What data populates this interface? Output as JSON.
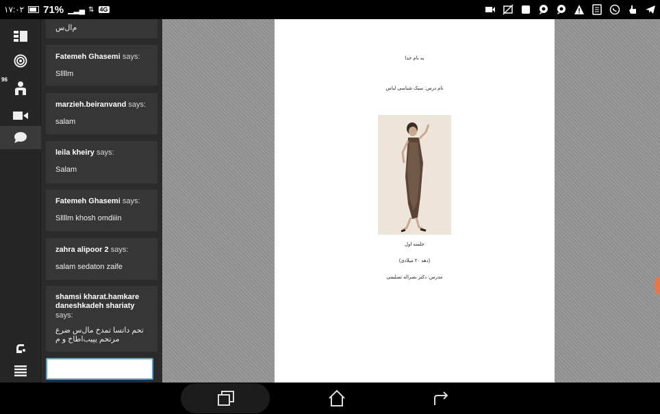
{
  "status_bar": {
    "time": "١٧:٠٢",
    "battery_percent": "71%",
    "network": "4G",
    "icons": [
      "video-icon",
      "image-off-icon",
      "square-icon",
      "chat-bubble-icon",
      "chat-bubble-icon",
      "warning-icon",
      "document-icon",
      "whatsapp-icon",
      "hand-icon",
      "telegram-icon"
    ]
  },
  "rail": {
    "badge": "96",
    "items": [
      "layout-icon",
      "target-icon",
      "participants-icon",
      "camera-icon",
      "chat-icon"
    ],
    "bottom_items": [
      "hand-raise-icon",
      "menu-icon"
    ]
  },
  "chat": {
    "partial_text": "م‌ال‌س",
    "says_label": "says:",
    "messages": [
      {
        "author": "Fatemeh Ghasemi",
        "text": "Sllllm"
      },
      {
        "author": "marzieh.beiranvand",
        "text": "salam"
      },
      {
        "author": "leila kheiry",
        "text": "Salam"
      },
      {
        "author": "Fatemeh Ghasemi",
        "text": "Sllllm khosh omdiiin"
      },
      {
        "author": "zahra alipoor 2",
        "text": "salam sedaton zaife"
      },
      {
        "author": "shamsi kharat.hamkare daneshkadeh shariaty",
        "text": "تحم داتسا تمدخ مال‌س ضرع مرتحم یپیب‌اطاخ و م"
      }
    ],
    "input_value": ""
  },
  "slide": {
    "line1": "به نام خدا",
    "line2": "نام درس: سبک شناسی لباس",
    "line3": "جلسه اول",
    "line4": "(دهه ۲۰ میلادی)",
    "line5": "مدرس: دکتر نصراله تسلیمی"
  },
  "navbar": {
    "buttons": [
      "recent-apps-icon",
      "home-icon",
      "back-icon"
    ]
  }
}
